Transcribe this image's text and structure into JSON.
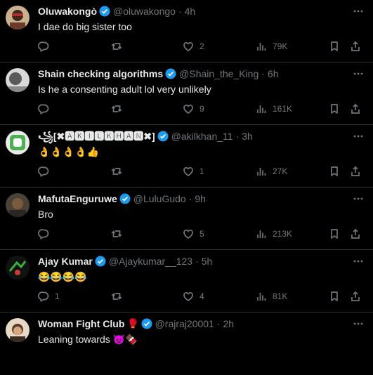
{
  "colors": {
    "background": "#000000",
    "text": "#e7e9ea",
    "muted": "#71767b",
    "verified": "#1d9bf0",
    "divider": "#2f3336"
  },
  "icons": [
    "reply-icon",
    "retweet-icon",
    "like-icon",
    "views-icon",
    "bookmark-icon",
    "share-icon",
    "more-icon",
    "verified-badge-icon"
  ],
  "tweets": [
    {
      "name": "Oluwakongò",
      "handle": "@oluwakongo",
      "time": "4h",
      "text": "I dae do big sister too",
      "replies": "",
      "retweets": "",
      "likes": "2",
      "views": "79K"
    },
    {
      "name": "Shain checking algorithms",
      "handle": "@Shain_the_King",
      "time": "6h",
      "text": "Is he a consenting adult  lol very unlikely",
      "replies": "",
      "retweets": "",
      "likes": "9",
      "views": "161K"
    },
    {
      "name": "꧁[✖🅰🅺🅸🅻🅺🅷🅰🅽✖]",
      "handle": "@akilkhan_11",
      "time": "3h",
      "text": "👌👌👌👌👍",
      "replies": "",
      "retweets": "",
      "likes": "1",
      "views": "27K"
    },
    {
      "name": "MafutaEnguruwe",
      "handle": "@LuluGudo",
      "time": "9h",
      "text": "Bro",
      "replies": "",
      "retweets": "",
      "likes": "5",
      "views": "213K"
    },
    {
      "name": "Ajay Kumar",
      "handle": "@Ajaykumar__123",
      "time": "5h",
      "text": "😂😂😂😂",
      "replies": "1",
      "retweets": "",
      "likes": "4",
      "views": "81K"
    },
    {
      "name": "Woman Fight Club",
      "name_emoji": "🥊",
      "handle": "@rajraj20001",
      "time": "2h",
      "text": "Leaning towards 😈🍫",
      "replies": "",
      "retweets": "",
      "likes": "",
      "views": ""
    }
  ]
}
